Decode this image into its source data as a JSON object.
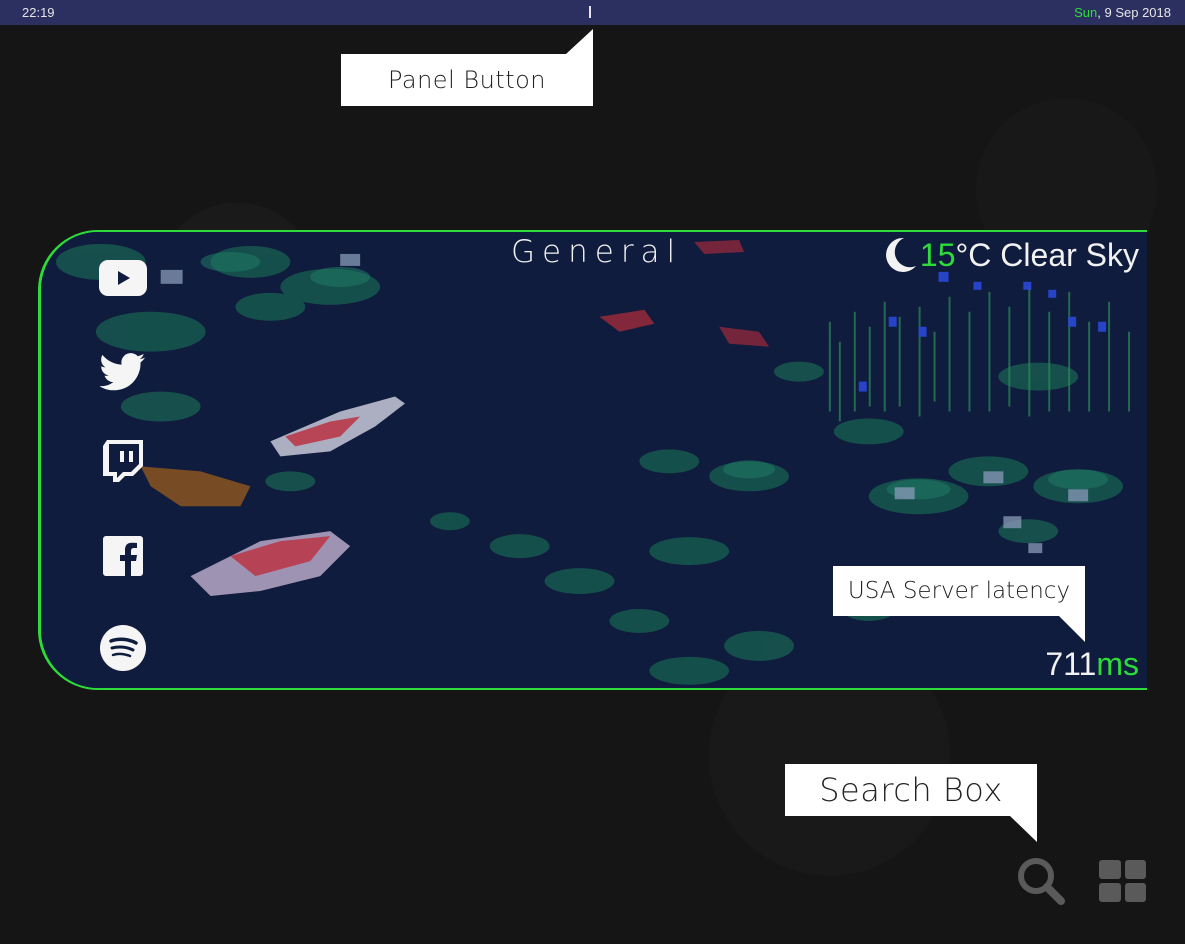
{
  "topbar": {
    "time": "22:19",
    "day": "Sun",
    "date": ", 9 Sep 2018"
  },
  "callouts": {
    "panel_button": "Panel Button",
    "search_box": "Search Box",
    "latency": "USA Server latency"
  },
  "panel": {
    "title": "General",
    "weather": {
      "icon": "moon-icon",
      "temp": "15",
      "unit_condition": "°C Clear Sky"
    },
    "latency": {
      "value": "711",
      "unit": "ms"
    },
    "social": [
      "youtube-icon",
      "twitter-icon",
      "twitch-icon",
      "facebook-icon",
      "spotify-icon"
    ]
  },
  "bottom_icons": [
    "search-icon",
    "grid-icon"
  ],
  "colors": {
    "accent": "#2ddc3a",
    "topbar": "#2b3060",
    "background": "#151515",
    "panel_bg": "#0e1a3b"
  }
}
